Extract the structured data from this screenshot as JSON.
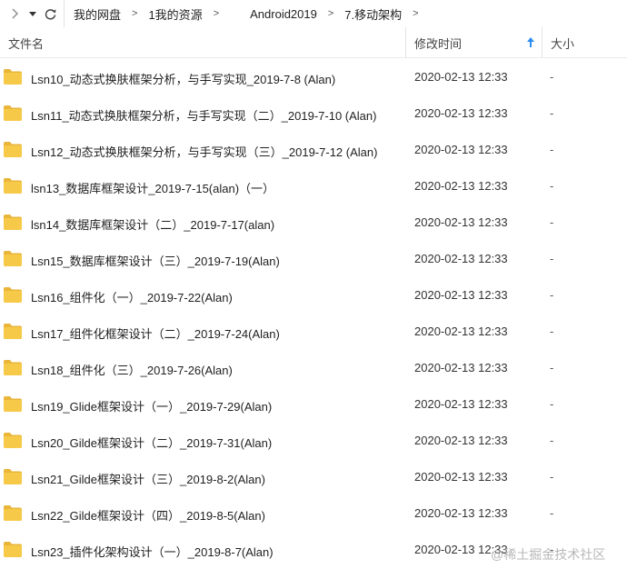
{
  "breadcrumb": [
    "我的网盘",
    "1我的资源",
    "Android2019",
    "7.移动架构"
  ],
  "columns": {
    "name": "文件名",
    "date": "修改时间",
    "size": "大小"
  },
  "files": [
    {
      "name": "Lsn10_动态式换肤框架分析，与手写实现_2019-7-8 (Alan)",
      "date": "2020-02-13 12:33",
      "size": "-"
    },
    {
      "name": "Lsn11_动态式换肤框架分析，与手写实现（二）_2019-7-10 (Alan)",
      "date": "2020-02-13 12:33",
      "size": "-"
    },
    {
      "name": "Lsn12_动态式换肤框架分析，与手写实现（三）_2019-7-12 (Alan)",
      "date": "2020-02-13 12:33",
      "size": "-"
    },
    {
      "name": "lsn13_数据库框架设计_2019-7-15(alan)（一）",
      "date": "2020-02-13 12:33",
      "size": "-"
    },
    {
      "name": "lsn14_数据库框架设计（二）_2019-7-17(alan)",
      "date": "2020-02-13 12:33",
      "size": "-"
    },
    {
      "name": "Lsn15_数据库框架设计（三）_2019-7-19(Alan)",
      "date": "2020-02-13 12:33",
      "size": "-"
    },
    {
      "name": "Lsn16_组件化（一）_2019-7-22(Alan)",
      "date": "2020-02-13 12:33",
      "size": "-"
    },
    {
      "name": "Lsn17_组件化框架设计（二）_2019-7-24(Alan)",
      "date": "2020-02-13 12:33",
      "size": "-"
    },
    {
      "name": "Lsn18_组件化（三）_2019-7-26(Alan)",
      "date": "2020-02-13 12:33",
      "size": "-"
    },
    {
      "name": "Lsn19_Glide框架设计（一）_2019-7-29(Alan)",
      "date": "2020-02-13 12:33",
      "size": "-"
    },
    {
      "name": "Lsn20_Gilde框架设计（二）_2019-7-31(Alan)",
      "date": "2020-02-13 12:33",
      "size": "-"
    },
    {
      "name": "Lsn21_Gilde框架设计（三）_2019-8-2(Alan)",
      "date": "2020-02-13 12:33",
      "size": "-"
    },
    {
      "name": "Lsn22_Gilde框架设计（四）_2019-8-5(Alan)",
      "date": "2020-02-13 12:33",
      "size": "-"
    },
    {
      "name": "Lsn23_插件化架构设计（一）_2019-8-7(Alan)",
      "date": "2020-02-13 12:33",
      "size": "-"
    }
  ],
  "watermark": "@稀土掘金技术社区",
  "icons": {
    "back": "chevron-right-icon",
    "history": "dropdown-arrow-icon",
    "refresh": "refresh-icon",
    "folder": "folder-icon",
    "sort": "sort-ascending-icon"
  },
  "colors": {
    "folder": "#f7c948",
    "folder_tab": "#e9b53a",
    "sort_arrow": "#2d8cf0"
  }
}
